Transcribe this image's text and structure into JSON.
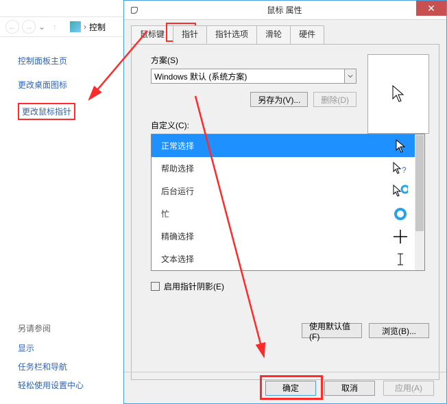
{
  "nav": {
    "breadcrumb": "控制"
  },
  "sidebar": {
    "home": "控制面板主页",
    "links": [
      "更改桌面图标",
      "更改鼠标指针"
    ],
    "see_also": "另请参阅",
    "footer_links": [
      "显示",
      "任务栏和导航",
      "轻松使用设置中心"
    ]
  },
  "dialog": {
    "title": "鼠标 属性",
    "tabs": [
      "鼠标键",
      "指针",
      "指针选项",
      "滑轮",
      "硬件"
    ],
    "active_tab": 1,
    "scheme_label": "方案(S)",
    "scheme_value": "Windows 默认 (系统方案)",
    "save_as": "另存为(V)...",
    "delete": "删除(D)",
    "customize_label": "自定义(C):",
    "items": [
      {
        "label": "正常选择",
        "icon": "cursor-arrow",
        "selected": true
      },
      {
        "label": "帮助选择",
        "icon": "cursor-help"
      },
      {
        "label": "后台运行",
        "icon": "cursor-working"
      },
      {
        "label": "忙",
        "icon": "cursor-busy"
      },
      {
        "label": "精确选择",
        "icon": "cursor-cross"
      },
      {
        "label": "文本选择",
        "icon": "cursor-ibeam"
      }
    ],
    "shadow": "启用指针阴影(E)",
    "use_default": "使用默认值(F)",
    "browse": "浏览(B)...",
    "ok": "确定",
    "cancel": "取消",
    "apply": "应用(A)"
  }
}
